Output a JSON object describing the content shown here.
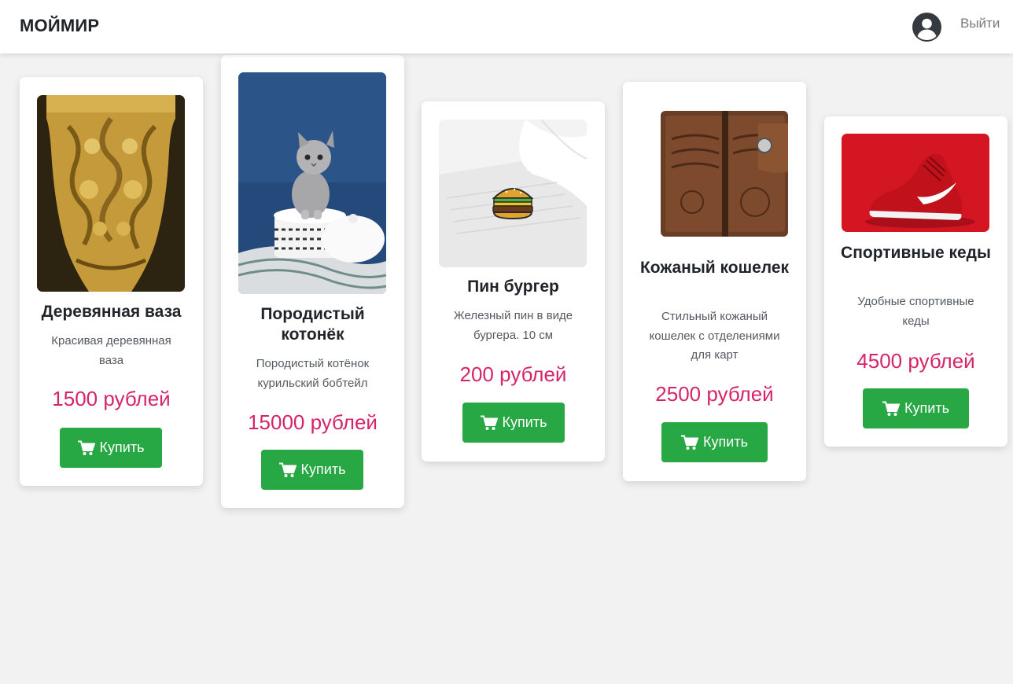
{
  "brand": "МОЙМИР",
  "nav": {
    "logout_label": "Выйти"
  },
  "products": [
    {
      "title": "Деревянная ваза",
      "description": "Красивая деревянная ваза",
      "price": "1500 рублей",
      "buy_label": "Купить",
      "image": "vase-photo"
    },
    {
      "title": "Породистый котонёк",
      "description": "Породистый котёнок курильский бобтейл",
      "price": "15000 рублей",
      "buy_label": "Купить",
      "image": "kitten-photo"
    },
    {
      "title": "Пин бургер",
      "description": "Железный пин в виде бургера. 10 см",
      "price": "200 рублей",
      "buy_label": "Купить",
      "image": "burger-pin-photo"
    },
    {
      "title": "Кожаный кошелек",
      "description": "Стильный кожаный кошелек с отделениями для карт",
      "price": "2500 рублей",
      "buy_label": "Купить",
      "image": "wallet-photo"
    },
    {
      "title": "Спортивные кеды",
      "description": "Удобные спортивные кеды",
      "price": "4500 рублей",
      "buy_label": "Купить",
      "image": "sneaker-photo"
    }
  ],
  "colors": {
    "price": "#d6246a",
    "buy_button": "#28a745",
    "background": "#f2f2f2"
  }
}
